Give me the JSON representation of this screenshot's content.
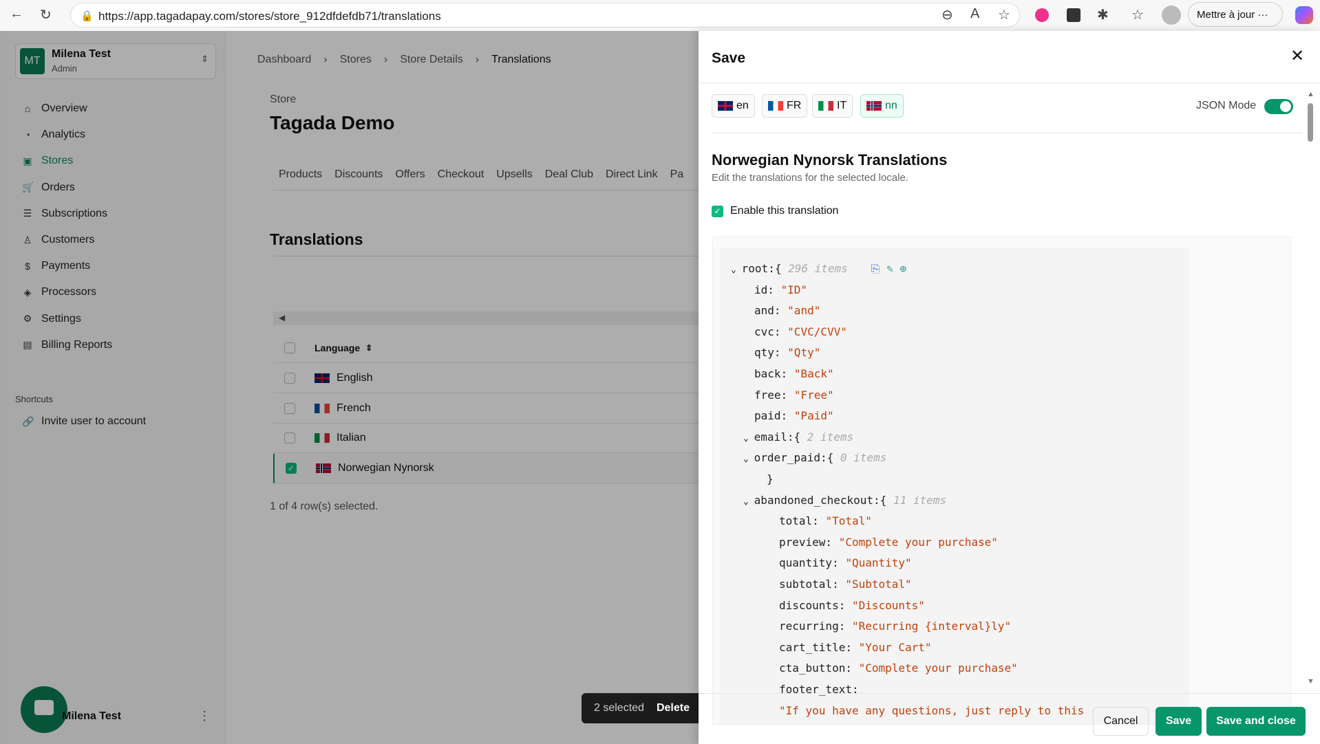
{
  "browser": {
    "url": "https://app.tagadapay.com/stores/store_912dfdefdb71/translations",
    "update_label": "Mettre à jour"
  },
  "sidebar": {
    "user": {
      "initials": "MT",
      "name": "Milena Test",
      "role": "Admin"
    },
    "items": [
      {
        "label": "Overview",
        "icon": "home-icon"
      },
      {
        "label": "Analytics",
        "icon": "pie-chart-icon"
      },
      {
        "label": "Stores",
        "icon": "store-icon",
        "active": true
      },
      {
        "label": "Orders",
        "icon": "cart-icon"
      },
      {
        "label": "Subscriptions",
        "icon": "list-icon"
      },
      {
        "label": "Customers",
        "icon": "user-icon"
      },
      {
        "label": "Payments",
        "icon": "dollar-icon"
      },
      {
        "label": "Processors",
        "icon": "processor-icon"
      },
      {
        "label": "Settings",
        "icon": "gear-icon"
      },
      {
        "label": "Billing Reports",
        "icon": "report-icon"
      }
    ],
    "shortcuts_label": "Shortcuts",
    "shortcut_item": "Invite user to account",
    "footer_name": "Milena Test"
  },
  "main": {
    "breadcrumb": [
      "Dashboard",
      "Stores",
      "Store Details",
      "Translations"
    ],
    "store_label": "Store",
    "store_name": "Tagada Demo",
    "tabs": [
      "Products",
      "Discounts",
      "Offers",
      "Checkout",
      "Upsells",
      "Deal Club",
      "Direct Link",
      "Pa"
    ],
    "section_title": "Translations",
    "column_language": "Language",
    "rows": [
      {
        "label": "English",
        "flag": "gb",
        "checked": false
      },
      {
        "label": "French",
        "flag": "fr",
        "checked": false
      },
      {
        "label": "Italian",
        "flag": "it",
        "checked": false
      },
      {
        "label": "Norwegian Nynorsk",
        "flag": "no",
        "checked": true
      }
    ],
    "selection_status": "1 of 4 row(s) selected.",
    "bulk_bar": {
      "selected": "2 selected",
      "delete": "Delete"
    }
  },
  "drawer": {
    "title": "Save",
    "locales": [
      {
        "label": "en",
        "flag": "gb"
      },
      {
        "label": "FR",
        "flag": "fr"
      },
      {
        "label": "IT",
        "flag": "it"
      },
      {
        "label": "nn",
        "flag": "no",
        "selected": true
      }
    ],
    "json_mode_label": "JSON Mode",
    "json_mode": true,
    "heading": "Norwegian Nynorsk Translations",
    "subheading": "Edit the translations for the selected locale.",
    "enable_label": "Enable this translation",
    "enabled": true,
    "json_lines": [
      {
        "indent": 0,
        "toggle": true,
        "key": "root:{",
        "meta": "296 items"
      },
      {
        "indent": 1,
        "key": "id: ",
        "value": "\"ID\""
      },
      {
        "indent": 1,
        "key": "and: ",
        "value": "\"and\""
      },
      {
        "indent": 1,
        "key": "cvc: ",
        "value": "\"CVC/CVV\""
      },
      {
        "indent": 1,
        "key": "qty: ",
        "value": "\"Qty\""
      },
      {
        "indent": 1,
        "key": "back: ",
        "value": "\"Back\""
      },
      {
        "indent": 1,
        "key": "free: ",
        "value": "\"Free\""
      },
      {
        "indent": 1,
        "key": "paid: ",
        "value": "\"Paid\""
      },
      {
        "indent": 1,
        "toggle": true,
        "key": "email:{",
        "meta": "2 items"
      },
      {
        "indent": 2,
        "toggle": true,
        "key": "order_paid:{",
        "meta": "0 items"
      },
      {
        "indent": 2,
        "key": "}"
      },
      {
        "indent": 2,
        "toggle": true,
        "key": "abandoned_checkout:{",
        "meta": "11 items"
      },
      {
        "indent": 3,
        "key": "total: ",
        "value": "\"Total\""
      },
      {
        "indent": 3,
        "key": "preview: ",
        "value": "\"Complete your purchase\""
      },
      {
        "indent": 3,
        "key": "quantity: ",
        "value": "\"Quantity\""
      },
      {
        "indent": 3,
        "key": "subtotal: ",
        "value": "\"Subtotal\""
      },
      {
        "indent": 3,
        "key": "discounts: ",
        "value": "\"Discounts\""
      },
      {
        "indent": 3,
        "key": "recurring: ",
        "value": "\"Recurring {interval}ly\""
      },
      {
        "indent": 3,
        "key": "cart_title: ",
        "value": "\"Your Cart\""
      },
      {
        "indent": 3,
        "key": "cta_button: ",
        "value": "\"Complete your purchase\""
      },
      {
        "indent": 3,
        "key": "footer_text:"
      },
      {
        "indent": 3,
        "key": "",
        "value": "\"If you have any questions, just reply to this"
      }
    ],
    "cancel": "Cancel",
    "save": "Save",
    "save_close": "Save and close"
  },
  "colors": {
    "accent": "#079669",
    "string": "#c2410c"
  }
}
